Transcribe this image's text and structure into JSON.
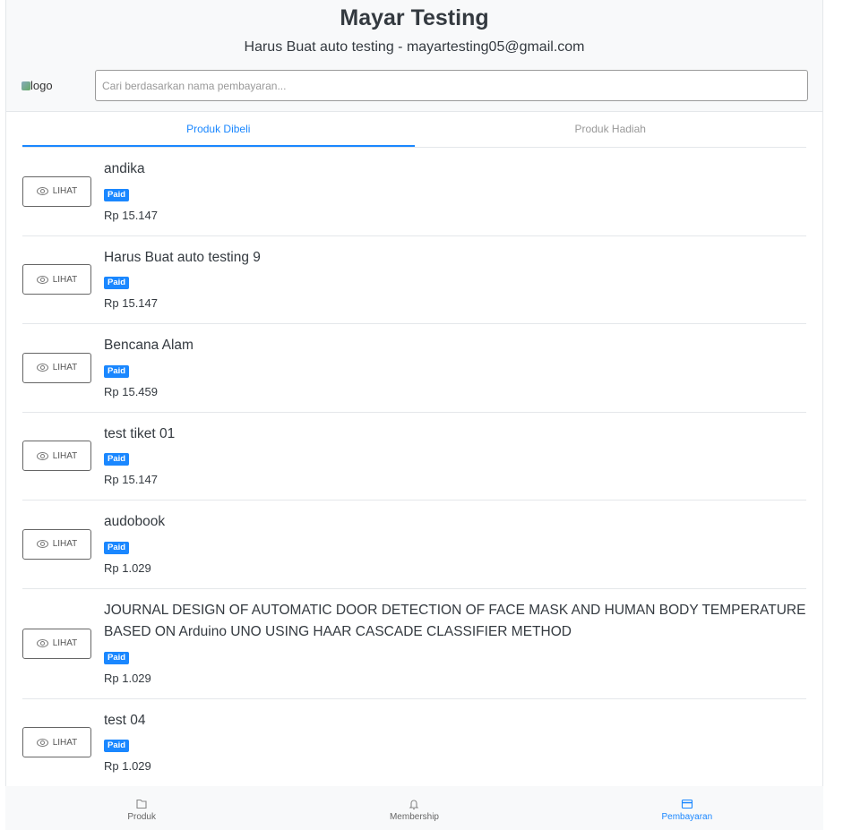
{
  "header": {
    "title": "Mayar Testing",
    "subtitle": "Harus Buat auto testing - mayartesting05@gmail.com",
    "logo_alt": "logo",
    "search_placeholder": "Cari berdasarkan nama pembayaran..."
  },
  "tabs": [
    {
      "label": "Produk Dibeli",
      "active": true
    },
    {
      "label": "Produk Hadiah",
      "active": false
    }
  ],
  "button_label": "LIHAT",
  "items": [
    {
      "title": "andika",
      "status": "Paid",
      "price": "Rp 15.147"
    },
    {
      "title": "Harus Buat auto testing 9",
      "status": "Paid",
      "price": "Rp 15.147"
    },
    {
      "title": "Bencana Alam",
      "status": "Paid",
      "price": "Rp 15.459"
    },
    {
      "title": "test tiket 01",
      "status": "Paid",
      "price": "Rp 15.147"
    },
    {
      "title": "audobook",
      "status": "Paid",
      "price": "Rp 1.029"
    },
    {
      "title": "JOURNAL DESIGN OF AUTOMATIC DOOR DETECTION OF FACE MASK AND HUMAN BODY TEMPERATURE BASED ON Arduino UNO USING HAAR CASCADE CLASSIFIER METHOD",
      "status": "Paid",
      "price": "Rp 1.029"
    },
    {
      "title": "test 04",
      "status": "Paid",
      "price": "Rp 1.029"
    }
  ],
  "nav": [
    {
      "label": "Produk",
      "icon": "folder-icon"
    },
    {
      "label": "Membership",
      "icon": "bell-icon"
    },
    {
      "label": "Pembayaran",
      "icon": "credit-card-icon",
      "active": true
    }
  ],
  "colors": {
    "accent": "#1a87ff"
  }
}
